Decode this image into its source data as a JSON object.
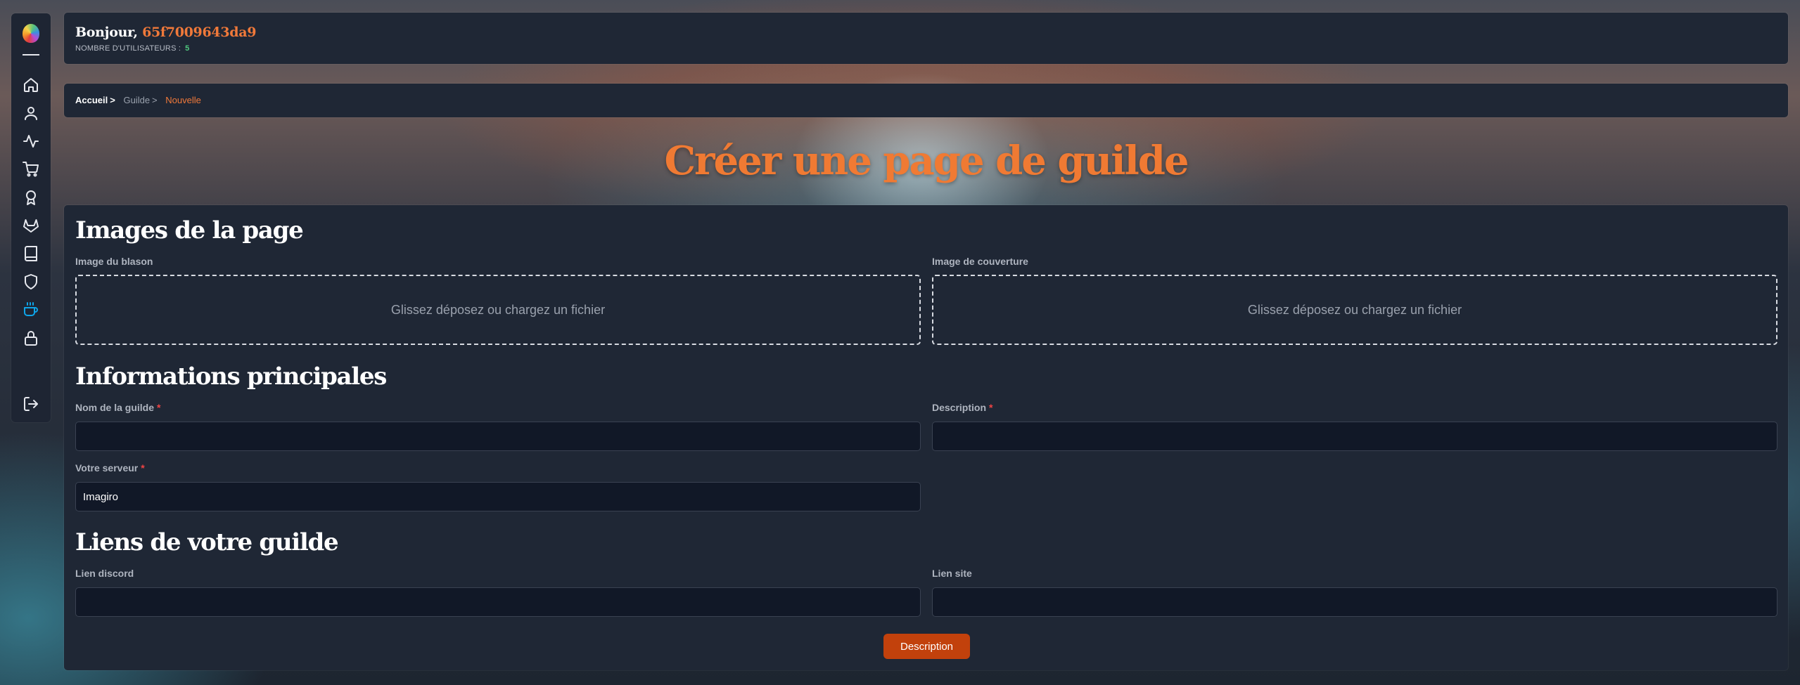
{
  "header": {
    "greeting": "Bonjour,",
    "username": "65f7009643da9",
    "users_label": "NOMBRE D'UTILISATEURS :",
    "users_count": "5"
  },
  "breadcrumb": {
    "home": "Accueil",
    "separator": ">",
    "middle": "Guilde",
    "current": "Nouvelle"
  },
  "sidebar": {
    "items": [
      {
        "icon": "home-icon"
      },
      {
        "icon": "user-icon"
      },
      {
        "icon": "activity-icon"
      },
      {
        "icon": "cart-icon"
      },
      {
        "icon": "award-icon"
      },
      {
        "icon": "gitlab-icon"
      },
      {
        "icon": "book-icon"
      },
      {
        "icon": "shield-icon"
      },
      {
        "icon": "coffee-icon",
        "active": true
      },
      {
        "icon": "lock-icon"
      },
      {
        "icon": "logout-icon"
      }
    ],
    "active_color": "#0ea5e9"
  },
  "page": {
    "title": "Créer une page de guilde"
  },
  "form": {
    "images_section": "Images de la page",
    "crest_label": "Image du blason",
    "cover_label": "Image de couverture",
    "dropzone_text": "Glissez déposez ou chargez un fichier",
    "main_section": "Informations principales",
    "name_label": "Nom de la guilde",
    "description_label": "Description",
    "server_label": "Votre serveur",
    "server_value": "Imagiro",
    "required_mark": "*",
    "links_section": "Liens de votre guilde",
    "discord_label": "Lien discord",
    "site_label": "Lien site",
    "submit_label": "Description"
  },
  "colors": {
    "accent": "#f07a33",
    "card": "#1f2735",
    "input_bg": "#111827",
    "button": "#c2410c",
    "success": "#4fc97e",
    "required": "#ef4444"
  }
}
